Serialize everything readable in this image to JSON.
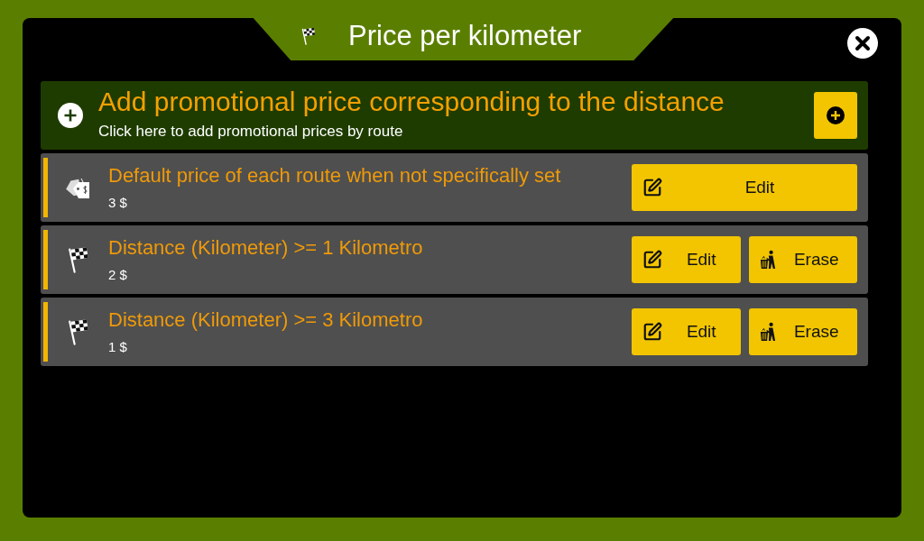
{
  "window": {
    "title": "Price per kilometer"
  },
  "promotion": {
    "title": "Add promotional price corresponding to the distance",
    "subtitle": "Click here to add promotional prices by route"
  },
  "prices": [
    {
      "kind": "default",
      "title": "Default price of each route when not specifically set",
      "price": "3 $",
      "actions": [
        {
          "kind": "edit",
          "label": "Edit"
        }
      ]
    },
    {
      "kind": "distance",
      "title": "Distance (Kilometer) >= 1 Kilometro",
      "price": "2 $",
      "actions": [
        {
          "kind": "edit",
          "label": "Edit"
        },
        {
          "kind": "erase",
          "label": "Erase"
        }
      ]
    },
    {
      "kind": "distance",
      "title": "Distance (Kilometer) >= 3 Kilometro",
      "price": "1 $",
      "actions": [
        {
          "kind": "edit",
          "label": "Edit"
        },
        {
          "kind": "erase",
          "label": "Erase"
        }
      ]
    }
  ]
}
